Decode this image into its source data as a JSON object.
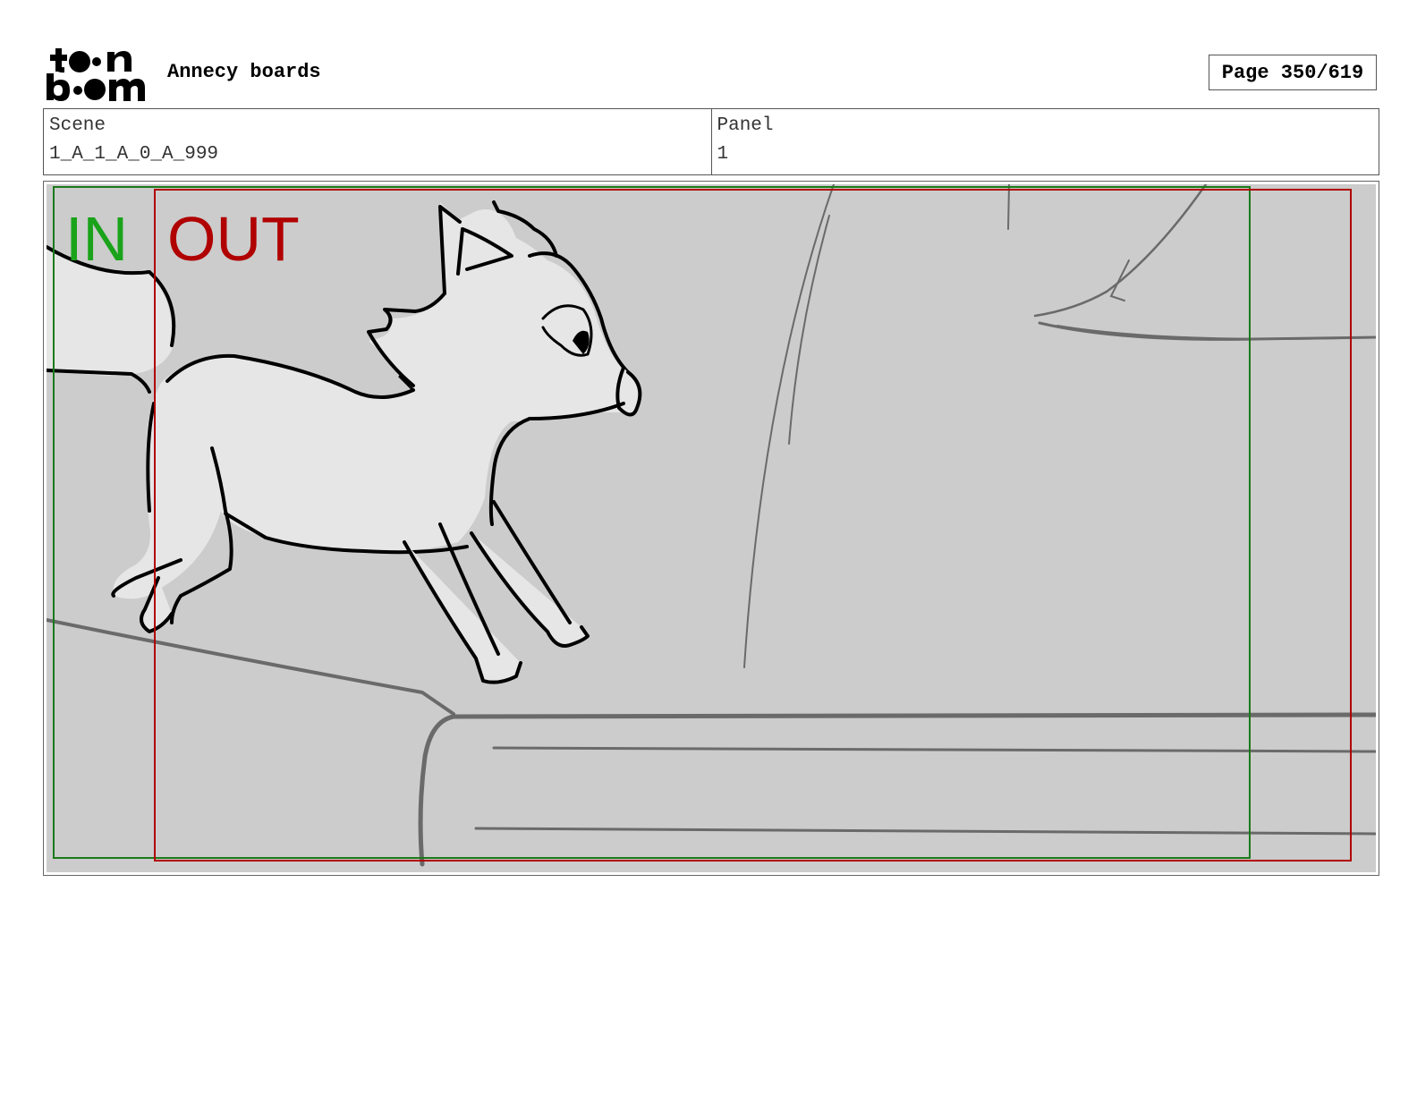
{
  "header": {
    "logo_text": "toon boom",
    "title": "Annecy boards",
    "page_indicator": "Page 350/619"
  },
  "info": {
    "scene_label": "Scene",
    "scene_value": "1_A_1_A_0_A_999",
    "panel_label": "Panel",
    "panel_value": "1"
  },
  "panel": {
    "in_label": "IN",
    "out_label": "OUT",
    "colors": {
      "in_frame": "#1a7a1a",
      "out_frame": "#b00000",
      "background": "#cccccc"
    }
  }
}
